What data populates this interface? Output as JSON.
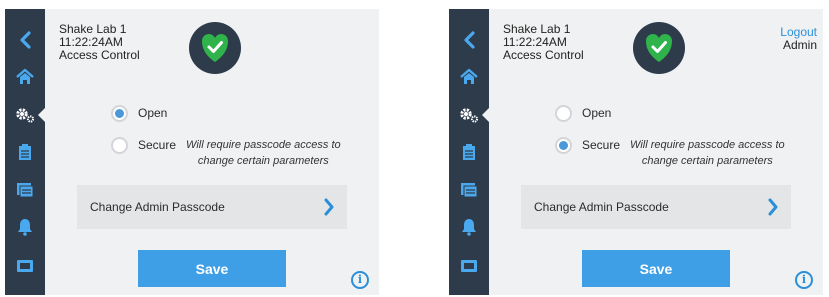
{
  "colors": {
    "sidebar": "#2d3b4b",
    "accent": "#3f9fe6",
    "link": "#2a8fd8",
    "shield": "#2fb34a",
    "panel": "#f0f1f2"
  },
  "nav_icons": [
    "back-chevron-icon",
    "home-icon",
    "gears-icon",
    "clipboard-icon",
    "folders-icon",
    "bell-icon",
    "display-icon"
  ],
  "screens": [
    {
      "header": {
        "device": "Shake Lab 1",
        "time": "11:22:24AM",
        "page": "Access Control"
      },
      "status": {
        "icon": "shield-check-icon"
      },
      "user": null,
      "mode": {
        "open_label": "Open",
        "secure_label": "Secure",
        "secure_description_line1": "Will require passcode access to",
        "secure_description_line2": "change certain parameters",
        "selected": "Open"
      },
      "change_passcode_label": "Change Admin Passcode",
      "save_label": "Save",
      "info_label": "i"
    },
    {
      "header": {
        "device": "Shake Lab 1",
        "time": "11:22:24AM",
        "page": "Access Control"
      },
      "status": {
        "icon": "shield-check-icon"
      },
      "user": {
        "logout_label": "Logout",
        "name": "Admin"
      },
      "mode": {
        "open_label": "Open",
        "secure_label": "Secure",
        "secure_description_line1": "Will require passcode access to",
        "secure_description_line2": "change certain parameters",
        "selected": "Secure"
      },
      "change_passcode_label": "Change Admin Passcode",
      "save_label": "Save",
      "info_label": "i"
    }
  ]
}
